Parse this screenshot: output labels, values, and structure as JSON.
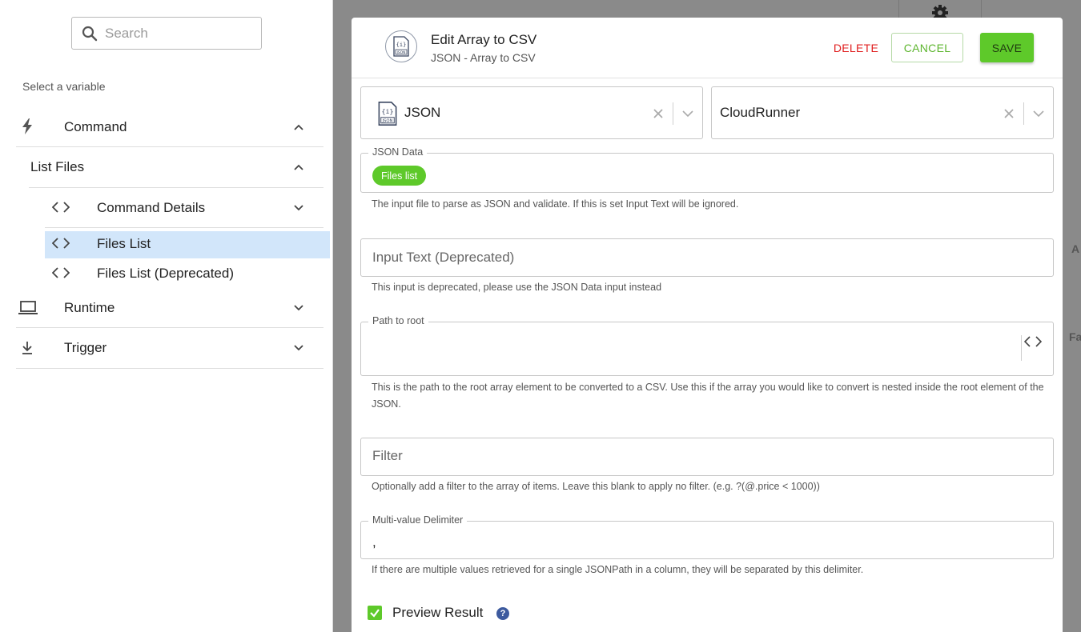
{
  "sidebar": {
    "search": {
      "placeholder": "Search",
      "value": ""
    },
    "select_label": "Select a variable",
    "items": {
      "command": {
        "label": "Command"
      },
      "list_files": {
        "label": "List Files"
      },
      "command_details": {
        "label": "Command Details"
      },
      "files_list": {
        "label": "Files List",
        "selected": true
      },
      "files_list_deprecated": {
        "label": "Files List (Deprecated)"
      },
      "runtime": {
        "label": "Runtime"
      },
      "trigger": {
        "label": "Trigger"
      }
    }
  },
  "background": {
    "text_a": "A",
    "text_fa": "Fa"
  },
  "modal": {
    "title": "Edit Array to CSV",
    "subtitle": "JSON - Array to CSV",
    "delete_label": "DELETE",
    "cancel_label": "CANCEL",
    "save_label": "SAVE",
    "app_select": {
      "value": "JSON"
    },
    "runner_select": {
      "value": "CloudRunner"
    },
    "json_data": {
      "legend": "JSON Data",
      "chip": "Files list",
      "helper": "The input file to parse as JSON and validate. If this is set Input Text will be ignored."
    },
    "input_text": {
      "placeholder": "Input Text (Deprecated)",
      "helper": "This input is deprecated, please use the JSON Data input instead"
    },
    "path_to_root": {
      "legend": "Path to root",
      "value": "",
      "helper": "This is the path to the root array element to be converted to a CSV. Use this if the array you would like to convert is nested inside the root element of the JSON."
    },
    "filter": {
      "placeholder": "Filter",
      "helper": "Optionally add a filter to the array of items. Leave this blank to apply no filter. (e.g. ?(@.price < 1000))"
    },
    "delimiter": {
      "legend": "Multi-value Delimiter",
      "value": ",",
      "helper": "If there are multiple values retrieved for a single JSONPath in a column, they will be separated by this delimiter."
    },
    "preview": {
      "label": "Preview Result",
      "checked": true,
      "help": "?"
    }
  },
  "colors": {
    "accent_green": "#5ec92a",
    "delete_red": "#e02020",
    "selected_row": "#d2e6fa",
    "help_blue": "#3d5a9e"
  },
  "icons": {
    "search": "search-icon",
    "bolt": "bolt-icon",
    "code": "code-icon",
    "laptop": "laptop-icon",
    "trigger": "download-arrow-icon",
    "gear": "gear-icon",
    "json_file": "json-file-icon"
  }
}
